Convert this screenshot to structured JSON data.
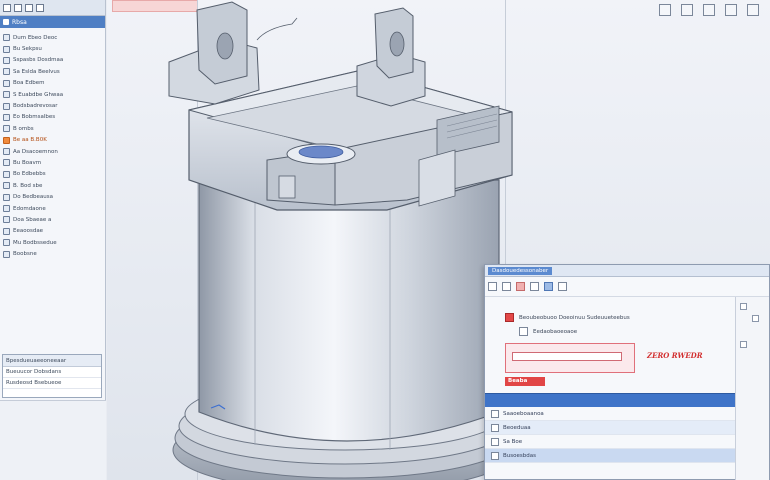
{
  "tree": {
    "header": "Rbsa",
    "items": [
      {
        "label": "Dum Ebeo Deoc",
        "style": "normal"
      },
      {
        "label": "Bu Sekpsu",
        "style": "normal"
      },
      {
        "label": "Sspasbs Dosdmaa",
        "style": "normal"
      },
      {
        "label": "Sa Eslda Beelvus",
        "style": "normal"
      },
      {
        "label": "Boa Edbem",
        "style": "normal"
      },
      {
        "label": "S Euabdbe Ghwaa",
        "style": "normal"
      },
      {
        "label": "Bodsbadrevosar",
        "style": "normal"
      },
      {
        "label": "Eo Bobmsalbes",
        "style": "normal"
      },
      {
        "label": "B ombs",
        "style": "normal"
      },
      {
        "label": "Be aa B.B0K",
        "style": "orange"
      },
      {
        "label": "Aa Dsacoemnon",
        "style": "normal"
      },
      {
        "label": "Bu Boavm",
        "style": "normal"
      },
      {
        "label": "Bo Edbebbs",
        "style": "normal"
      },
      {
        "label": "B. Bod sbe",
        "style": "normal"
      },
      {
        "label": "Do Bedbeausa",
        "style": "normal"
      },
      {
        "label": "Edomdaone",
        "style": "normal"
      },
      {
        "label": "Doa Sbaeae a",
        "style": "normal"
      },
      {
        "label": "Eeaoosdae",
        "style": "normal"
      },
      {
        "label": "Mu Bodbssedue",
        "style": "normal"
      },
      {
        "label": "Boobsne",
        "style": "normal"
      }
    ],
    "panel": {
      "title": "Bpesdueuaeeoneeaar",
      "rows": [
        "Bueuucor Dobsdans",
        "Rusdeosd Bsebueoe"
      ]
    }
  },
  "viewport": {
    "dialog": {
      "title": "Dasdouedessonaber",
      "field_label": "Beoubeobuoo Doeoinuu Sudeuueteebus",
      "sub_label": "Eedaobaoeoaoe",
      "red_label": "ZERO RWEDR",
      "red_tag": "Beaba",
      "list": [
        {
          "label": "Saaoeboaanoa",
          "style": "normal"
        },
        {
          "label": "Beoeduaa",
          "style": "alt"
        },
        {
          "label": "Sa Boe",
          "style": "normal"
        },
        {
          "label": "Busoesbdas",
          "style": "hl"
        }
      ]
    }
  },
  "colors": {
    "accent_blue": "#3f74c8",
    "warning_red": "#e14646",
    "tree_highlight": "#f08a3c"
  }
}
